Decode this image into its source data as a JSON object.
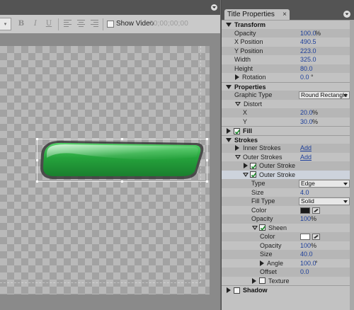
{
  "left_toolbar": {
    "bold": "B",
    "italic": "I",
    "underline": "U",
    "show_video_label": "Show Video",
    "timecode": "00;00;00;00"
  },
  "panel": {
    "tab_title": "Title Properties",
    "tab_close": "×"
  },
  "transform": {
    "label": "Transform",
    "opacity": {
      "label": "Opacity",
      "value": "100.0",
      "unit": "%"
    },
    "x_position": {
      "label": "X Position",
      "value": "490.5"
    },
    "y_position": {
      "label": "Y Position",
      "value": "223.0"
    },
    "width": {
      "label": "Width",
      "value": "325.0"
    },
    "height": {
      "label": "Height",
      "value": "80.0"
    },
    "rotation": {
      "label": "Rotation",
      "value": "0.0",
      "unit": "°"
    }
  },
  "properties": {
    "label": "Properties",
    "graphic_type": {
      "label": "Graphic Type",
      "value": "Round Rectangle"
    },
    "distort": {
      "label": "Distort"
    },
    "distort_x": {
      "label": "X",
      "value": "20.0",
      "unit": "%"
    },
    "distort_y": {
      "label": "Y",
      "value": "30.0",
      "unit": "%"
    }
  },
  "fill": {
    "label": "Fill"
  },
  "strokes": {
    "label": "Strokes",
    "inner": {
      "label": "Inner Strokes",
      "action": "Add"
    },
    "outer": {
      "label": "Outer Strokes",
      "action": "Add"
    },
    "outer_stroke_1": {
      "label": "Outer Stroke"
    },
    "outer_stroke_2": {
      "label": "Outer Stroke"
    },
    "type": {
      "label": "Type",
      "value": "Edge"
    },
    "size": {
      "label": "Size",
      "value": "4.0"
    },
    "fill_type": {
      "label": "Fill Type",
      "value": "Solid"
    },
    "color": {
      "label": "Color",
      "swatch": "#1a1a1a"
    },
    "opacity": {
      "label": "Opacity",
      "value": "100",
      "unit": "%"
    },
    "sheen": {
      "label": "Sheen",
      "color": {
        "label": "Color",
        "swatch": "#ffffff"
      },
      "opacity": {
        "label": "Opacity",
        "value": "100",
        "unit": "%"
      },
      "size": {
        "label": "Size",
        "value": "40.0"
      },
      "angle": {
        "label": "Angle",
        "value": "100.0",
        "unit": "°"
      },
      "offset": {
        "label": "Offset",
        "value": "0.0"
      }
    },
    "texture": {
      "label": "Texture"
    }
  },
  "shadow": {
    "label": "Shadow"
  },
  "colors": {
    "value_blue": "#1e3f9a",
    "shape_green": "#2fa845",
    "panel_bg": "#c2c2c2"
  }
}
